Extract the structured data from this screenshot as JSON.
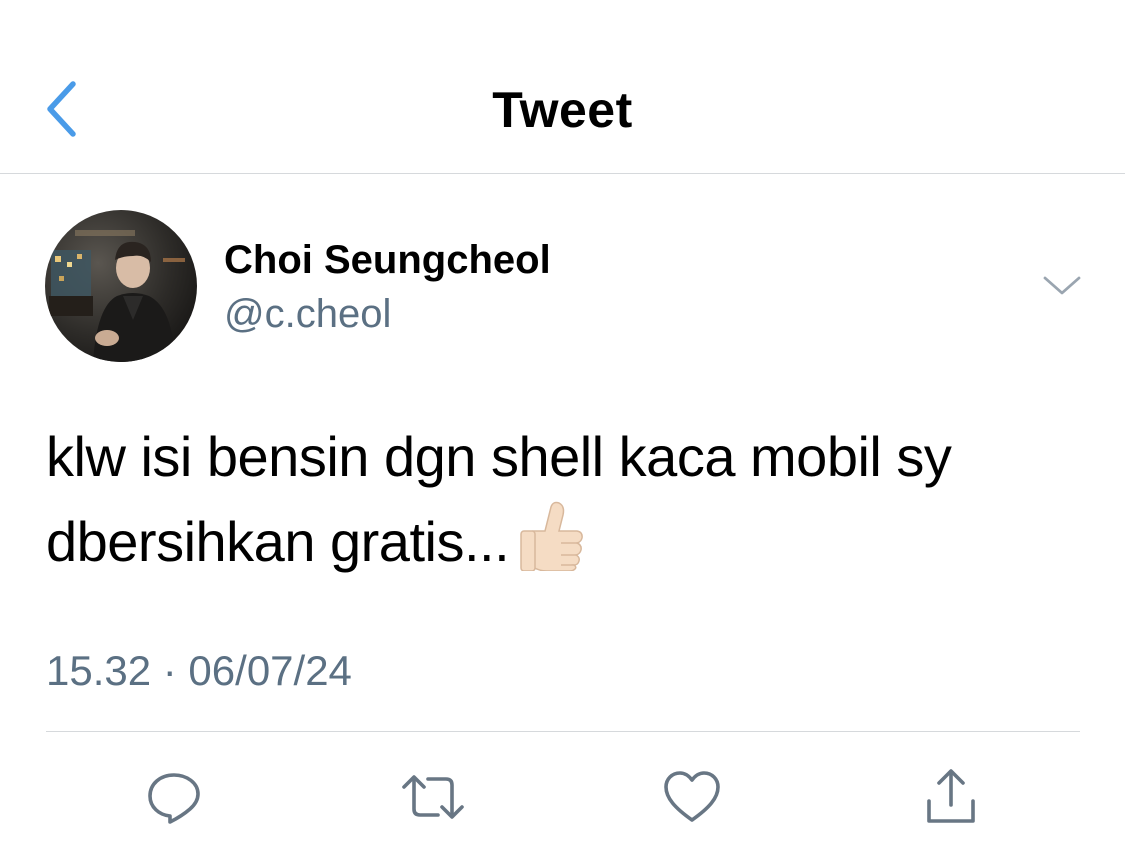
{
  "header": {
    "title": "Tweet",
    "back_icon": "chevron-left-icon"
  },
  "author": {
    "display_name": "Choi Seungcheol",
    "handle": "@c.cheol",
    "more_icon": "chevron-down-icon"
  },
  "tweet": {
    "text_line1": "klw isi bensin dgn shell kaca mobil sy",
    "text_line2": "dbersihkan gratis...",
    "emoji": "thumbs-up-light-skin-tone",
    "timestamp": "15.32 · 06/07/24"
  },
  "actions": [
    {
      "name": "reply",
      "icon": "reply-bubble-icon"
    },
    {
      "name": "retweet",
      "icon": "retweet-icon"
    },
    {
      "name": "like",
      "icon": "heart-icon"
    },
    {
      "name": "share",
      "icon": "share-icon"
    }
  ],
  "colors": {
    "accent": "#4a9be8",
    "secondary_text": "#5b7083",
    "icon_gray": "#687684",
    "divider": "#d6d9dc"
  }
}
